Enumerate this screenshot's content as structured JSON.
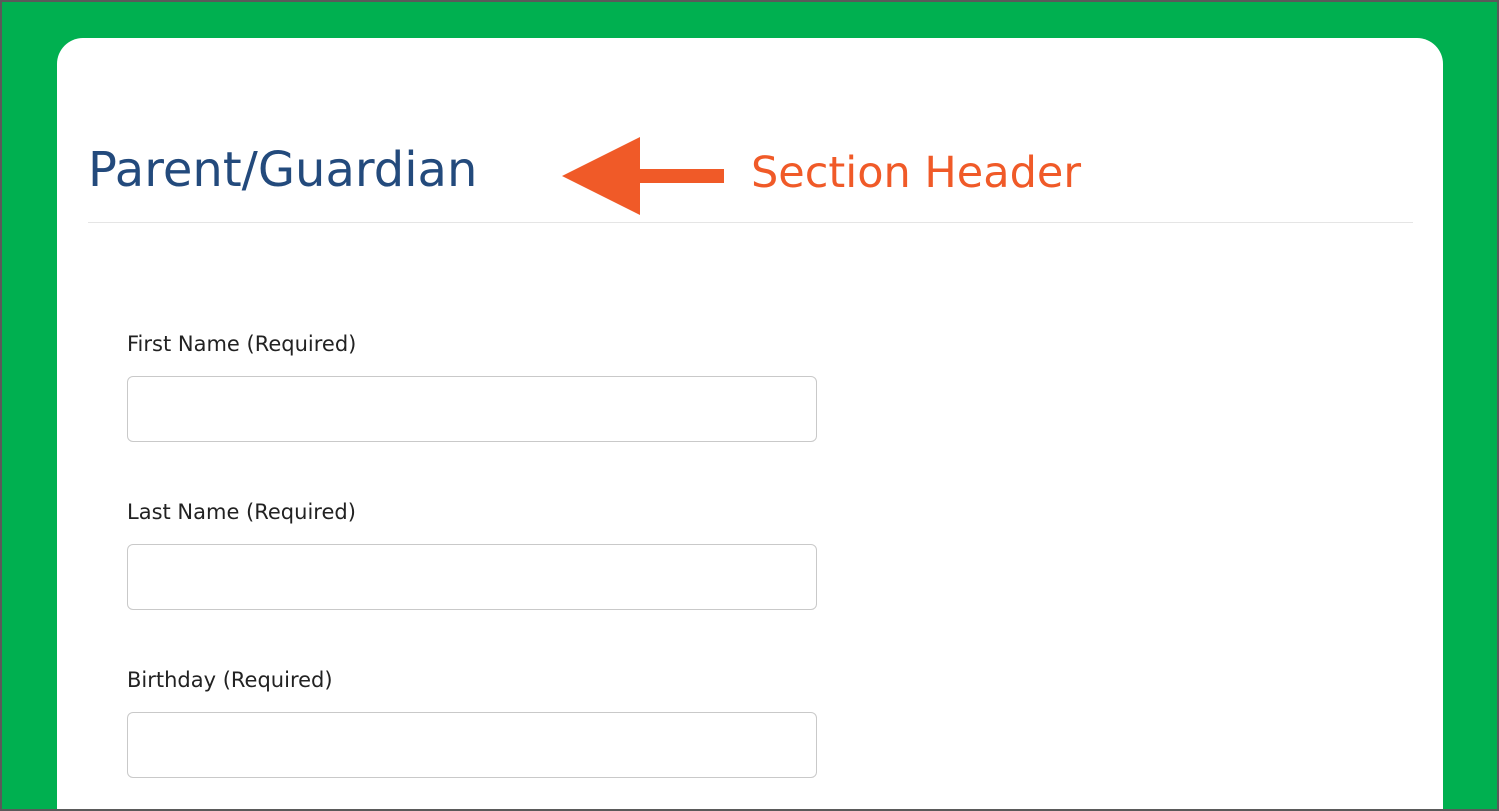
{
  "section": {
    "title": "Parent/Guardian"
  },
  "annotation": {
    "label": "Section Header",
    "color": "#f05a28",
    "icon": "left-arrow-icon"
  },
  "form": {
    "fields": [
      {
        "label": "First Name (Required)",
        "value": "",
        "placeholder": ""
      },
      {
        "label": "Last Name (Required)",
        "value": "",
        "placeholder": ""
      },
      {
        "label": "Birthday (Required)",
        "value": "",
        "placeholder": ""
      }
    ]
  },
  "colors": {
    "frame_background": "#00b050",
    "card_background": "#ffffff",
    "title": "#234a7c",
    "annotation": "#f05a28"
  }
}
